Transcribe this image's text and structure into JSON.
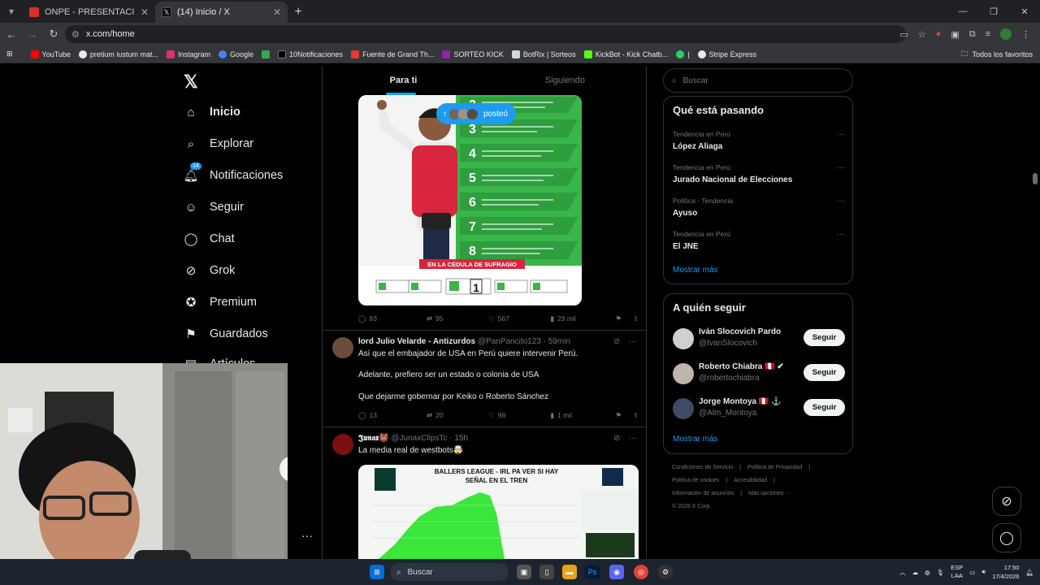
{
  "browser": {
    "tabs": [
      {
        "title": "ONPE - PRESENTACIÓN DE RESULTADOS",
        "close": "✕",
        "favicon_color": "#d93025"
      },
      {
        "title": "(14) Inicio / X",
        "close": "✕",
        "favicon_color": "#000000"
      }
    ],
    "new_tab": "+",
    "url": "x.com/home",
    "bookmarks": [
      {
        "label": "YouTube",
        "color": "#ff0000"
      },
      {
        "label": "pretium iustum mat...",
        "color": "#e8eaed"
      },
      {
        "label": "Instagram",
        "color": "#e1306c"
      },
      {
        "label": "Google",
        "color": "#4285f4"
      },
      {
        "label": "",
        "color": "#34a853"
      },
      {
        "label": "10Notificaciones",
        "color": "#000000"
      },
      {
        "label": "Fuente de Grand Th...",
        "color": "#e53935"
      },
      {
        "label": "SORTEO KICK",
        "color": "#8e24aa"
      },
      {
        "label": "BotRix | Sorteos",
        "color": "#cfd8dc"
      },
      {
        "label": "KickBot - Kick Chatb...",
        "color": "#53fc18"
      },
      {
        "label": "|",
        "color": "#25d366"
      },
      {
        "label": "Stripe Express",
        "color": "#e8eaed"
      }
    ],
    "bookmarks_all": "Todos los favoritos"
  },
  "x": {
    "nav": [
      {
        "label": "Inicio",
        "icon": "home-icon"
      },
      {
        "label": "Explorar",
        "icon": "search-icon"
      },
      {
        "label": "Notificaciones",
        "icon": "bell-icon",
        "badge": "14"
      },
      {
        "label": "Seguir",
        "icon": "follow-icon"
      },
      {
        "label": "Chat",
        "icon": "chat-icon"
      },
      {
        "label": "Grok",
        "icon": "grok-icon"
      },
      {
        "label": "Premium",
        "icon": "premium-icon"
      },
      {
        "label": "Guardados",
        "icon": "bookmark-icon"
      },
      {
        "label": "Artículos",
        "icon": "article-icon"
      }
    ],
    "feed_tabs": [
      "Para ti",
      "Siguiendo"
    ],
    "new_posts_pill": "posteó",
    "posts": [
      {
        "replies": "83",
        "reposts": "95",
        "likes": "567",
        "views": "29 mil"
      },
      {
        "name": "lord Julio Velarde - Antizurdos",
        "handle": "@PanPancito123",
        "time": "· 59min",
        "lines": [
          "Así que el embajador de USA en Perú quiere intervenir Perú.",
          "Adelante, prefiero ser un estado o colonia de USA",
          "Que dejarme gobernar por Keiko o Roberto Sánchez"
        ],
        "replies": "13",
        "reposts": "20",
        "likes": "98",
        "views": "1 mil"
      },
      {
        "name": "𝕵𝖚𝖓𝖆𝖝👹",
        "handle": "@JunaxClipsTc",
        "time": "· 15h",
        "lines": [
          "La media real de westbots🤯"
        ],
        "image_title": "BALLERS LEAGUE - IRL PA VER SI HAY SEÑAL EN EL TREN"
      }
    ],
    "search_placeholder": "Buscar",
    "trending": {
      "title": "Qué está pasando",
      "items": [
        {
          "context": "Tendencia en Perú",
          "name": "López Aliaga"
        },
        {
          "context": "Tendencia en Perú",
          "name": "Jurado Nacional de Elecciones"
        },
        {
          "context": "Política · Tendencia",
          "name": "Ayuso"
        },
        {
          "context": "Tendencia en Perú",
          "name": "El JNE"
        }
      ],
      "more": "Mostrar más"
    },
    "who_to_follow": {
      "title": "A quién seguir",
      "users": [
        {
          "name": "Iván Slocovich Pardo",
          "handle": "@IvanSlocovich",
          "button": "Seguir"
        },
        {
          "name": "Roberto Chiabra 🇵🇪 ✔",
          "handle": "@robertochiabra",
          "button": "Seguir"
        },
        {
          "name": "Jorge Montoya 🇵🇪 ⚓",
          "handle": "@Alm_Montoya",
          "button": "Seguir"
        }
      ],
      "more": "Mostrar más"
    },
    "footer": [
      "Condiciones de Servicio",
      "|",
      "Política de Privacidad",
      "|",
      "Política de cookies",
      "|",
      "Accesibilidad",
      "|",
      "Información de anuncios",
      "|",
      "Más opciones ···",
      "© 2026 X Corp."
    ]
  },
  "taskbar": {
    "search": "Buscar",
    "lang": "ESP",
    "lang2": "LAA",
    "time": "17:50",
    "date": "17/4/2026"
  },
  "colors": {
    "accent": "#1d9bf0",
    "background": "#000000",
    "green_poster": "#39b54a",
    "red_vest": "#d7263d"
  }
}
